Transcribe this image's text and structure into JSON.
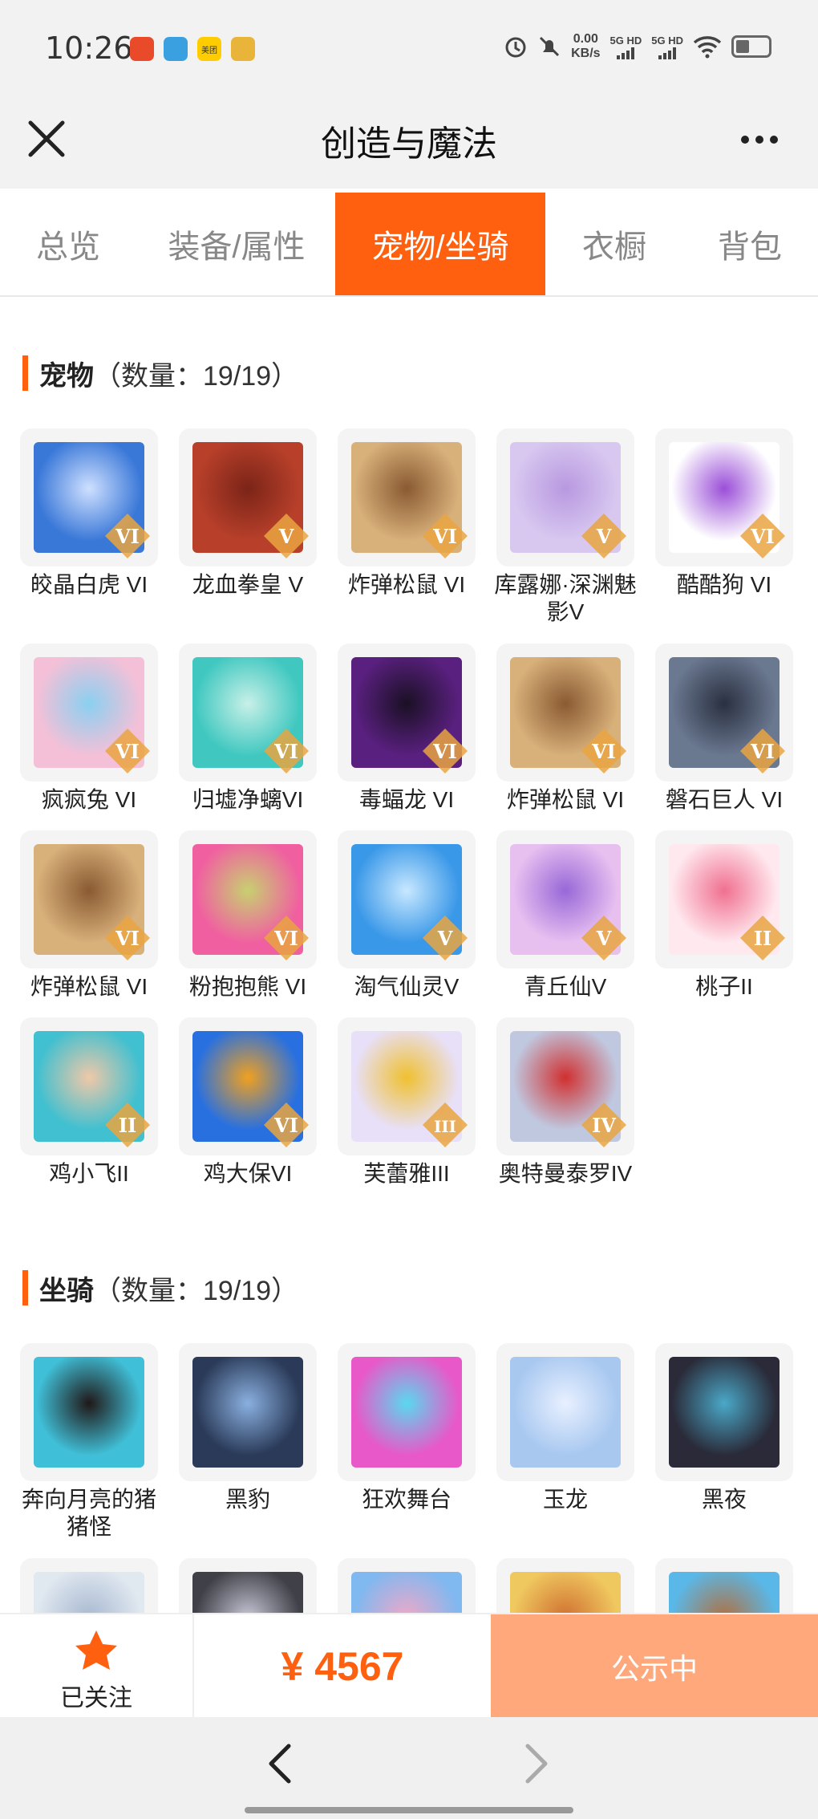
{
  "status": {
    "time": "10:26",
    "apps": [
      {
        "icon": "toolbox-app-icon",
        "color": "#e84a2a"
      },
      {
        "icon": "telegram-app-icon",
        "color": "#3aa0e0"
      },
      {
        "icon": "meituan-app-icon",
        "color": "#ffcc00",
        "text": "美团"
      },
      {
        "icon": "weibo-app-icon",
        "color": "#e8b43a"
      }
    ],
    "speed_value": "0.00",
    "speed_unit": "KB/s",
    "sim1": "5G HD",
    "sim2": "5G HD"
  },
  "titlebar": {
    "title": "创造与魔法"
  },
  "tabs": [
    {
      "label": "总览",
      "active": false
    },
    {
      "label": "装备/属性",
      "active": false
    },
    {
      "label": "宠物/坐骑",
      "active": true
    },
    {
      "label": "衣橱",
      "active": false
    },
    {
      "label": "背包",
      "active": false
    }
  ],
  "pets": {
    "heading": "宠物",
    "count": "（数量：19/19）",
    "items": [
      {
        "name": "皎晶白虎 VI",
        "rank": "VI",
        "colors": [
          "#3a78d8",
          "#cfe0ff"
        ]
      },
      {
        "name": "龙血拳皇 V",
        "rank": "V",
        "colors": [
          "#b8402a",
          "#7b2418"
        ]
      },
      {
        "name": "炸弹松鼠 VI",
        "rank": "VI",
        "colors": [
          "#d8b07a",
          "#8a5a32"
        ]
      },
      {
        "name": "库露娜·深渊魅影V",
        "rank": "V",
        "colors": [
          "#d8c8f0",
          "#b898e0"
        ]
      },
      {
        "name": "酷酷狗 VI",
        "rank": "VI",
        "colors": [
          "#ffffff",
          "#9b4fd8"
        ]
      },
      {
        "name": "疯疯兔 VI",
        "rank": "VI",
        "colors": [
          "#f4c0d8",
          "#8ad0f0"
        ]
      },
      {
        "name": "归墟净螭VI",
        "rank": "VI",
        "colors": [
          "#40c8c0",
          "#c8f0e8"
        ]
      },
      {
        "name": "毒蝠龙 VI",
        "rank": "VI",
        "colors": [
          "#5a2080",
          "#1a1024"
        ]
      },
      {
        "name": "炸弹松鼠 VI",
        "rank": "VI",
        "colors": [
          "#d8b07a",
          "#8a5a32"
        ]
      },
      {
        "name": "磐石巨人 VI",
        "rank": "VI",
        "colors": [
          "#6a7890",
          "#2a3040"
        ]
      },
      {
        "name": "炸弹松鼠 VI",
        "rank": "VI",
        "colors": [
          "#d8b07a",
          "#8a5a32"
        ]
      },
      {
        "name": "粉抱抱熊 VI",
        "rank": "VI",
        "colors": [
          "#f060a0",
          "#c8d070"
        ]
      },
      {
        "name": "淘气仙灵V",
        "rank": "V",
        "colors": [
          "#3a98e8",
          "#c8e8ff"
        ]
      },
      {
        "name": "青丘仙V",
        "rank": "V",
        "colors": [
          "#e8c0f0",
          "#9868d8"
        ]
      },
      {
        "name": "桃子II",
        "rank": "II",
        "colors": [
          "#ffe8ee",
          "#f07090"
        ]
      },
      {
        "name": "鸡小飞II",
        "rank": "II",
        "colors": [
          "#40c0d0",
          "#f0c8a8"
        ]
      },
      {
        "name": "鸡大保VI",
        "rank": "VI",
        "colors": [
          "#2870e0",
          "#f0a020"
        ]
      },
      {
        "name": "芙蕾雅III",
        "rank": "III",
        "colors": [
          "#e8e0f8",
          "#f0c030"
        ]
      },
      {
        "name": "奥特曼泰罗IV",
        "rank": "IV",
        "colors": [
          "#c0c8e0",
          "#d03030"
        ]
      }
    ]
  },
  "mounts": {
    "heading": "坐骑",
    "count": "（数量：19/19）",
    "items": [
      {
        "name": "奔向月亮的猪猪怪",
        "colors": [
          "#40c0d8",
          "#201818"
        ]
      },
      {
        "name": "黑豹",
        "colors": [
          "#2a3a58",
          "#8ab0e0"
        ]
      },
      {
        "name": "狂欢舞台",
        "colors": [
          "#e858c8",
          "#5ad8f0"
        ]
      },
      {
        "name": "玉龙",
        "colors": [
          "#a8c8f0",
          "#e8f0ff"
        ]
      },
      {
        "name": "黑夜",
        "colors": [
          "#2a2a38",
          "#4aa8c8"
        ]
      }
    ],
    "partial": [
      {
        "colors": [
          "#e0e8f0",
          "#a8b8d0"
        ]
      },
      {
        "colors": [
          "#404048",
          "#c8c8d8"
        ]
      },
      {
        "colors": [
          "#80b8f0",
          "#f0a8c8"
        ]
      },
      {
        "colors": [
          "#f0c860",
          "#d07030"
        ]
      },
      {
        "colors": [
          "#5ab8e8",
          "#b07040"
        ]
      }
    ]
  },
  "actions": {
    "follow_label": "已关注",
    "price": "¥ 4567",
    "status_label": "公示中"
  },
  "colors": {
    "accent": "#ff6010",
    "accent_light": "#ffa87c",
    "badge": "#e9a441"
  }
}
